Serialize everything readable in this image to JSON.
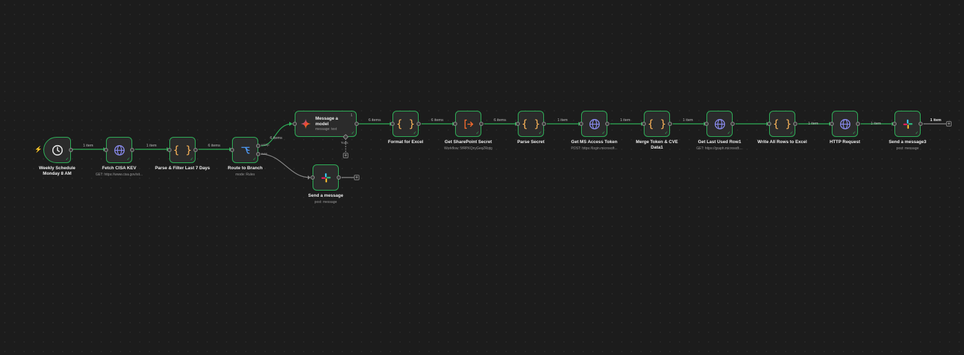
{
  "nodes": {
    "schedule": {
      "title_line1": "Weekly Schedule",
      "title_line2": "Monday 8 AM"
    },
    "fetch": {
      "title": "Fetch CISA KEV",
      "subtitle": "GET: https://www.cisa.gov/sit..."
    },
    "parse_filter": {
      "title": "Parse & Filter Last 7 Days"
    },
    "route": {
      "title": "Route to Branch",
      "subtitle": "mode: Rules",
      "out1": "unizip",
      "out2": "cves"
    },
    "model": {
      "title_line1": "Message a",
      "title_line2": "model",
      "subtitle": "message: text",
      "tools_label": "Tools"
    },
    "slack1": {
      "title": "Send a message",
      "subtitle": "post: message"
    },
    "format_excel": {
      "title": "Format for Excel"
    },
    "sharepoint": {
      "title": "Get SharePoint Secret",
      "subtitle": "Workflow: 5fRPKQnyGeqZRqtg"
    },
    "parse_secret": {
      "title": "Parse Secret"
    },
    "ms_token": {
      "title": "Get MS Access Token",
      "subtitle": "POST: https://login.microsoft..."
    },
    "merge": {
      "title_line1": "Merge Token & CVE",
      "title_line2": "Data1"
    },
    "last_row": {
      "title": "Get Last Used Row1",
      "subtitle": "GET: https://graph.microsoft...."
    },
    "write_rows": {
      "title": "Write All Rows to Excel"
    },
    "http": {
      "title": "HTTP Request"
    },
    "slack3": {
      "title": "Send a message3",
      "subtitle": "post: message"
    }
  },
  "edge_labels": {
    "e1": "1 item",
    "e2": "1 item",
    "e3": "6 items",
    "e4": "6 items",
    "e5": "6 items",
    "e6": "6 items",
    "e7": "6 items",
    "e8": "1 item",
    "e9": "1 item",
    "e10": "1 item",
    "e11": "1 item",
    "e12": "1 item",
    "e13": "1 item"
  },
  "ui": {
    "plus": "+",
    "check": "✓",
    "bolt": "⚡",
    "model_badge": "1"
  },
  "colors": {
    "success": "#2fb45a",
    "canvas": "#1c1c1c",
    "node": "#2b2b2b",
    "code_icon": "#ffb75a",
    "http_icon": "#8a8cf0",
    "router_icon": "#4f9cf9",
    "trigger_bolt": "#ff6d2d"
  },
  "icons": {
    "schedule": "clock-icon",
    "http": "globe-icon",
    "code": "code-braces-icon",
    "router": "switch-branch-icon",
    "model": "gemini-sparkle-icon",
    "slack": "slack-icon",
    "subworkflow": "execute-workflow-icon"
  }
}
